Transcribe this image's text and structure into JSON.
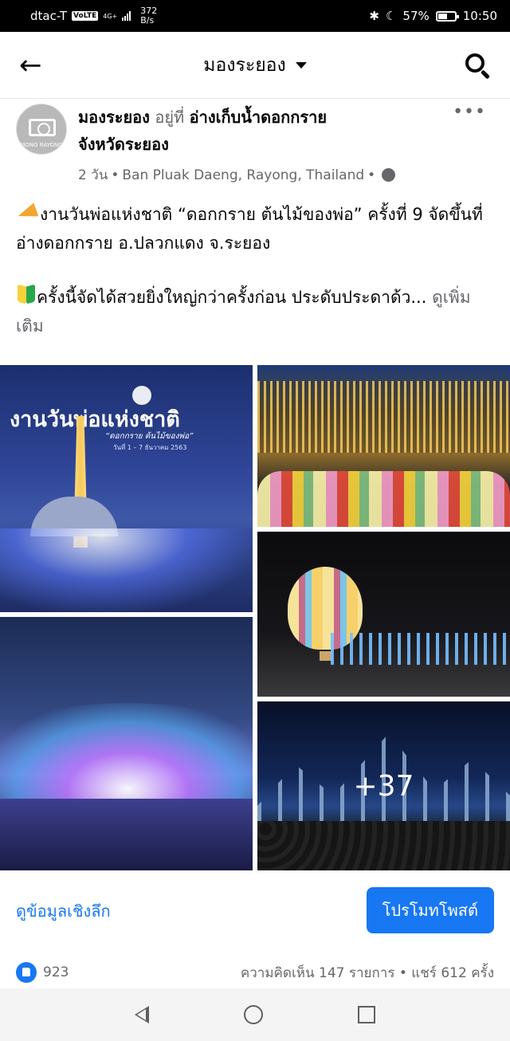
{
  "status_bar": {
    "carrier": "dtac-T",
    "volte": "VoLTE",
    "network": "4G+",
    "speed_value": "372",
    "speed_unit": "B/s",
    "battery": "57%",
    "battery_level": 0.57,
    "time": "10:50",
    "icons": [
      "bluetooth-icon",
      "moon-icon",
      "battery-icon"
    ]
  },
  "header": {
    "title": "มองระยอง",
    "icons": [
      "back-arrow-icon",
      "dropdown-caret-icon",
      "search-icon"
    ]
  },
  "post": {
    "page_name": "มองระยอง",
    "at_text": "อยู่ที่",
    "location_name": "อ่างเก็บน้ำดอกกราย",
    "province": "จังหวัดระยอง",
    "time_ago": "2 วัน",
    "location_detail": "Ban Pluak Daeng, Rayong, Thailand",
    "separator": "•",
    "avatar_brand": "MONG RAYONG",
    "body_line1": "งานวันพ่อแห่งชาติ “ดอกกราย ต้นไม้ของพ่อ” ครั้งที่ 9 จัดขึ้นที่อ่างดอกกราย อ.ปลวกแดง จ.ระยอง",
    "body_line2": "ครั้งนี้จัดได้สวยยิ่งใหญ่กว่าครั้งก่อน ประดับประดาด้ว...",
    "see_more": "ดูเพิ่มเติม"
  },
  "photos": {
    "poster_title": "งานวันพ่อแห่งชาติ",
    "poster_subtitle": "“ดอกกราย ต้นไม้ของพ่อ”",
    "poster_dates": "วันที่ 1 – 7 ธันวาคม 2563",
    "more_count": "+37"
  },
  "actions": {
    "insights": "ดูข้อมูลเชิงลึก",
    "promote": "โปรโมทโพสต์"
  },
  "stats": {
    "likes": "923",
    "comments_shares": "ความคิดเห็น 147 รายการ • แชร์ 612 ครั้ง"
  },
  "colors": {
    "accent": "#1877f2",
    "muted": "#65676b"
  }
}
